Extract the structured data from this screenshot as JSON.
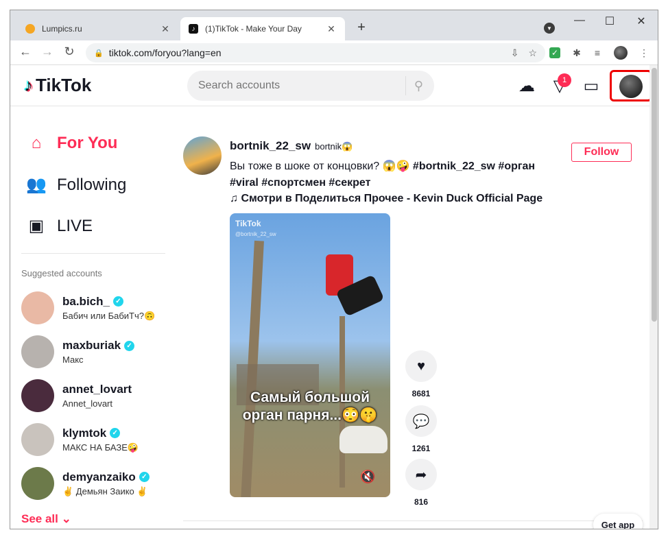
{
  "browser": {
    "tabs": [
      {
        "title": "Lumpics.ru",
        "active": false
      },
      {
        "title": "(1)TikTok - Make Your Day",
        "active": true
      }
    ],
    "new_tab": "+",
    "url": "tiktok.com/foryou?lang=en",
    "window_controls": {
      "minimize": "—",
      "maximize": "☐",
      "close": "✕"
    }
  },
  "header": {
    "logo_text": "TikTok",
    "search_placeholder": "Search accounts",
    "inbox_badge": "1"
  },
  "sidebar": {
    "menu": [
      {
        "label": "For You",
        "icon": "home-icon",
        "active": true
      },
      {
        "label": "Following",
        "icon": "people-icon",
        "active": false
      },
      {
        "label": "LIVE",
        "icon": "live-icon",
        "active": false
      }
    ],
    "suggested_heading": "Suggested accounts",
    "accounts": [
      {
        "username": "ba.bich_",
        "nickname": "Бабич или БабиТч?🙃",
        "verified": true,
        "color": "#e9b9a5"
      },
      {
        "username": "maxburiak",
        "nickname": "Макс",
        "verified": true,
        "color": "#b7b2ae"
      },
      {
        "username": "annet_lovart",
        "nickname": "Annet_lovart",
        "verified": false,
        "color": "#4a2b3d"
      },
      {
        "username": "klymtok",
        "nickname": "МАКС НА БАЗЕ🤪",
        "verified": true,
        "color": "#c9c3bd"
      },
      {
        "username": "demyanzaiko",
        "nickname": "✌ Демьян Заико ✌",
        "verified": true,
        "color": "#6c7a4a"
      }
    ],
    "see_all": "See all ⌄"
  },
  "post": {
    "username": "bortnik_22_sw",
    "nickname": "bortnik😱",
    "description_plain": "Вы тоже в шоке от концовки? 😱🤪 ",
    "hashtags_line1": "#bortnik_22_sw #орган",
    "hashtags_line2": "#viral #спортсмен #секрет",
    "music": "♫ Смотри в Поделиться Прочее - Kevin Duck Official Page",
    "follow_label": "Follow",
    "video_watermark": "TikTok",
    "video_watermark_user": "@bortnik_22_sw",
    "video_caption_line1": "Самый большой",
    "video_caption_line2": "орган парня...😳🤫",
    "likes": "8681",
    "comments": "1261",
    "shares": "816"
  },
  "get_app": "Get app"
}
